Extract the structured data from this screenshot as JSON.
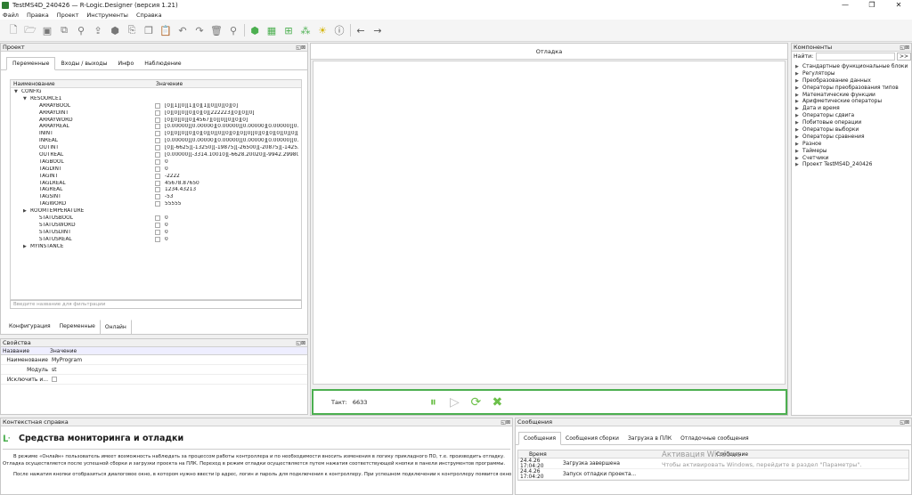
{
  "window": {
    "title": "TestMS4D_240426  —  R-Logic.Designer (версия 1.21)",
    "controls": [
      "—",
      "❐",
      "✕"
    ]
  },
  "menu": [
    "Файл",
    "Правка",
    "Проект",
    "Инструменты",
    "Справка"
  ],
  "toolbar": {
    "icons": [
      "new-icon",
      "open-icon",
      "save-icon",
      "save-all-icon",
      "build-icon",
      "upload-icon",
      "package-icon",
      "export-icon",
      "copy-icon",
      "paste-icon",
      "undo-icon",
      "redo-icon",
      "delete-icon",
      "search-icon",
      "module-icon",
      "blocks-icon",
      "network-icon",
      "hierarchy-icon",
      "light-icon",
      "info-icon",
      "back-icon",
      "forward-icon"
    ]
  },
  "project": {
    "title": "Проект",
    "tabs": [
      "Переменные",
      "Входы / выходы",
      "Инфо",
      "Наблюдение"
    ],
    "active_tab": "Переменные",
    "columns": [
      "Наименование",
      "Значение"
    ],
    "rows": [
      {
        "name": "CONFIG",
        "level": 0,
        "expand": "open",
        "checkbox": false,
        "value": ""
      },
      {
        "name": "RESOURCE1",
        "level": 1,
        "expand": "open",
        "checkbox": false,
        "value": ""
      },
      {
        "name": "ARRAYBOOL",
        "level": 2,
        "expand": "",
        "checkbox": true,
        "value": "[0][1][0][1][0][1][0][0][0][0]"
      },
      {
        "name": "ARRAYDINT",
        "level": 2,
        "expand": "",
        "checkbox": true,
        "value": "[0][0][0][0][0][0][222223][0][0][0]"
      },
      {
        "name": "ARRAYWORD",
        "level": 2,
        "expand": "",
        "checkbox": true,
        "value": "[0][0][0][0][4567][0][0][0][0][0]"
      },
      {
        "name": "ARRAYREAL",
        "level": 2,
        "expand": "",
        "checkbox": true,
        "value": "[0.00000][0.00000][0.00000][0.00000][0.00000][0.00..."
      },
      {
        "name": "ININT",
        "level": 2,
        "expand": "",
        "checkbox": true,
        "value": "[0][0][0][0][0][0][0][0][0][0][0][0][0][0][0][0][0][0][0]..."
      },
      {
        "name": "INREAL",
        "level": 2,
        "expand": "",
        "checkbox": true,
        "value": "[0.00000][0.00000][0.00000][0.00000][0.00000][0.00..."
      },
      {
        "name": "OUTINT",
        "level": 2,
        "expand": "",
        "checkbox": true,
        "value": "[0][-6625][-13250][-19875][-26500][-20875][-1425..."
      },
      {
        "name": "OUTREAL",
        "level": 2,
        "expand": "",
        "checkbox": true,
        "value": "[0.00000][-3314.10010][-6628.20020][-9942.29980]..."
      },
      {
        "name": "TAGBOOL",
        "level": 2,
        "expand": "",
        "checkbox": true,
        "value": "0"
      },
      {
        "name": "TAGDINT",
        "level": 2,
        "expand": "",
        "checkbox": true,
        "value": "0"
      },
      {
        "name": "TAGINT",
        "level": 2,
        "expand": "",
        "checkbox": true,
        "value": "-2222"
      },
      {
        "name": "TAGLREAL",
        "level": 2,
        "expand": "",
        "checkbox": true,
        "value": "45678.87650"
      },
      {
        "name": "TAGREAL",
        "level": 2,
        "expand": "",
        "checkbox": true,
        "value": "1234.43213"
      },
      {
        "name": "TAGSINT",
        "level": 2,
        "expand": "",
        "checkbox": true,
        "value": "-53"
      },
      {
        "name": "TAGWORD",
        "level": 2,
        "expand": "",
        "checkbox": true,
        "value": "55555"
      },
      {
        "name": "ROOMTEMPERATURE",
        "level": 1,
        "expand": "closed",
        "checkbox": false,
        "value": ""
      },
      {
        "name": "STATUSBOOL",
        "level": 2,
        "expand": "",
        "checkbox": true,
        "value": "0"
      },
      {
        "name": "STATUSWORD",
        "level": 2,
        "expand": "",
        "checkbox": true,
        "value": "0"
      },
      {
        "name": "STATUSDINT",
        "level": 2,
        "expand": "",
        "checkbox": true,
        "value": "0"
      },
      {
        "name": "STATUSREAL",
        "level": 2,
        "expand": "",
        "checkbox": true,
        "value": "0"
      },
      {
        "name": "MYINSTANCE",
        "level": 1,
        "expand": "closed",
        "checkbox": false,
        "value": ""
      }
    ],
    "filter_placeholder": "Введите название для фильтрации",
    "bottom_tabs": [
      "Конфигурация",
      "Переменные",
      "Онлайн"
    ],
    "active_bottom_tab": "Онлайн"
  },
  "properties": {
    "title": "Свойства",
    "columns": [
      "Название",
      "Значение"
    ],
    "rows": [
      {
        "key": "Наименование",
        "value": "MyProgram",
        "checkbox": false
      },
      {
        "key": "Модуль",
        "value": "st",
        "checkbox": false
      },
      {
        "key": "Исключить и...",
        "value": "",
        "checkbox": true
      }
    ]
  },
  "debug": {
    "title": "Отладка",
    "tact_label": "Такт:",
    "tact_value": "6633",
    "controls": [
      "pause-icon",
      "play-icon",
      "refresh-icon",
      "stop-icon"
    ]
  },
  "components": {
    "title": "Компоненты",
    "search_label": "Найти:",
    "search_button": ">>",
    "items": [
      "Стандартные функциональные блоки",
      "Регуляторы",
      "Преобразование данных",
      "Операторы преобразования типов",
      "Математические функции",
      "Арифметические операторы",
      "Дата и время",
      "Операторы сдвига",
      "Побитовые операции",
      "Операторы выборки",
      "Операторы сравнения",
      "Разное",
      "Таймеры",
      "Счетчики",
      "Проект TestMS4D_240426"
    ]
  },
  "help": {
    "title": "Контекстная справка",
    "heading": "Средства мониторинга и отладки",
    "paragraphs": [
      "В режиме «Онлайн» пользователь имеет возможность наблюдать за процессом работы контроллера и по необходимости вносить изменения в логику прикладного ПО, т.е. производить отладку.",
      "Отладка осуществляется после успешной сборки и загрузки проекта на ПЛК. Переход в режим отладки осуществляется путем нажатия соответствующей кнопки в панели инструментов программы.",
      "После нажатия кнопки отобразиться диалоговое окно, в котором нужно ввести ip адрес, логин и пароль для подключения к контроллеру. При успешном подключении к контроллеру появится окно с"
    ]
  },
  "messages": {
    "title": "Сообщения",
    "tabs": [
      "Сообщения",
      "Сообщения сборки",
      "Загрузка в ПЛК",
      "Отладочные сообщения"
    ],
    "active_tab": "Сообщения",
    "columns": [
      "Время",
      "Сообщение"
    ],
    "rows": [
      {
        "time": "24.4.26  17:04:20",
        "message": "Загрузка завершена"
      },
      {
        "time": "24.4.26  17:04:20",
        "message": "Запуск отладки проекта..."
      }
    ],
    "watermark_title": "Активация Windows",
    "watermark_text": "Чтобы активировать Windows, перейдите в раздел \"Параметры\"."
  },
  "panel_buttons": "◱⊠"
}
